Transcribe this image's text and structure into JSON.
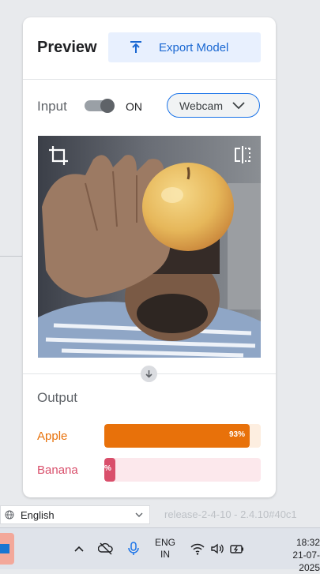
{
  "header": {
    "title": "Preview",
    "export_label": "Export Model"
  },
  "input": {
    "label": "Input",
    "toggle_state": "ON",
    "source": "Webcam"
  },
  "output": {
    "label": "Output",
    "classes": [
      {
        "name": "Apple",
        "confidence": 0.93,
        "pct_label": "93%",
        "color": "#e8710a",
        "bg": "#fdeee0"
      },
      {
        "name": "Banana",
        "confidence": 0.07,
        "pct_label": "%",
        "color": "#d94f6b",
        "bg": "#fce8ec"
      }
    ]
  },
  "footer": {
    "language": "English",
    "release": "release-2-4-10 - 2.4.10#40c1"
  },
  "taskbar": {
    "lang_line1": "ENG",
    "lang_line2": "IN",
    "time": "18:32",
    "date": "21-07-2025"
  },
  "colors": {
    "accent": "#1a73e8",
    "apple": "#e8710a",
    "banana": "#d94f6b"
  }
}
